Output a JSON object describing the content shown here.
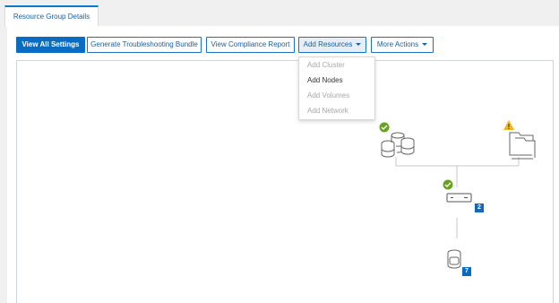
{
  "tabs": [
    {
      "label": "Resource Group Details"
    }
  ],
  "toolbar": {
    "view_all_settings": "View All Settings",
    "troubleshooting_bundle": "Generate Troubleshooting Bundle",
    "compliance_report": "View Compliance Report",
    "add_resources": "Add Resources",
    "more_actions": "More Actions"
  },
  "add_resources_menu": [
    {
      "label": "Add Cluster",
      "enabled": false
    },
    {
      "label": "Add Nodes",
      "enabled": true
    },
    {
      "label": "Add Volumes",
      "enabled": false
    },
    {
      "label": "Add Network",
      "enabled": false
    }
  ],
  "topology": {
    "nodes_count": "2",
    "volumes_count": "7",
    "status_colors": {
      "ok": "#6aa121",
      "warning": "#f2b51b"
    },
    "icons": [
      "storage-cluster-icon",
      "network-folder-icon",
      "server-node-icon",
      "volume-icon"
    ]
  },
  "colors": {
    "accent": "#0b6cbf",
    "badge": "#0b6cbf"
  }
}
